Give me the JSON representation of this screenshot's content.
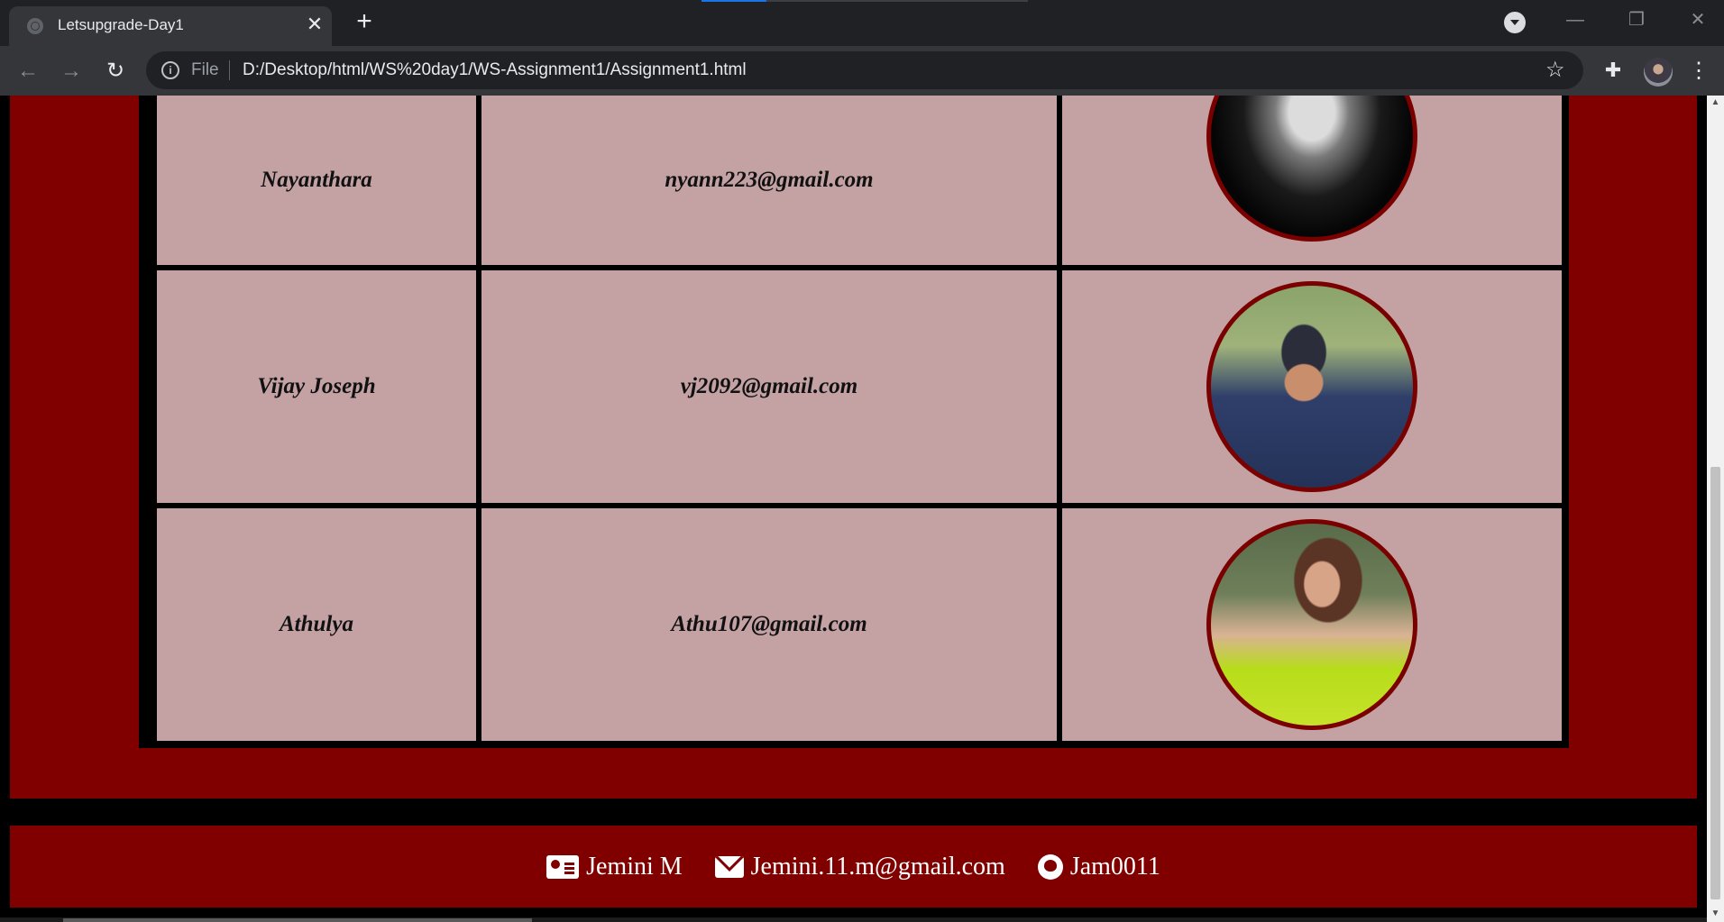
{
  "browser": {
    "tab_title": "Letsupgrade-Day1",
    "tab_close": "✕",
    "new_tab": "+",
    "scheme_label": "File",
    "url": "D:/Desktop/html/WS%20day1/WS-Assignment1/Assignment1.html",
    "info_glyph": "i",
    "star_glyph": "☆",
    "back_glyph": "←",
    "forward_glyph": "→",
    "reload_glyph": "↻",
    "extensions_glyph": "✚",
    "menu_glyph": "⋮",
    "min_glyph": "—",
    "restore_glyph": "❐",
    "close_glyph": "✕"
  },
  "table": {
    "rows": [
      {
        "name": "Nayanthara",
        "email": "nyann223@gmail.com",
        "photo_icon": "profile-photo-nayanthara"
      },
      {
        "name": "Vijay Joseph",
        "email": "vj2092@gmail.com",
        "photo_icon": "profile-photo-vijay"
      },
      {
        "name": "Athulya",
        "email": "Athu107@gmail.com",
        "photo_icon": "profile-photo-athulya"
      }
    ]
  },
  "footer": {
    "name": "Jemini M",
    "email": "Jemini.11.m@gmail.com",
    "github": "Jam0011"
  },
  "colors": {
    "panel": "#800000",
    "cell": "#c4a2a4",
    "photo_border": "#7a0000"
  }
}
